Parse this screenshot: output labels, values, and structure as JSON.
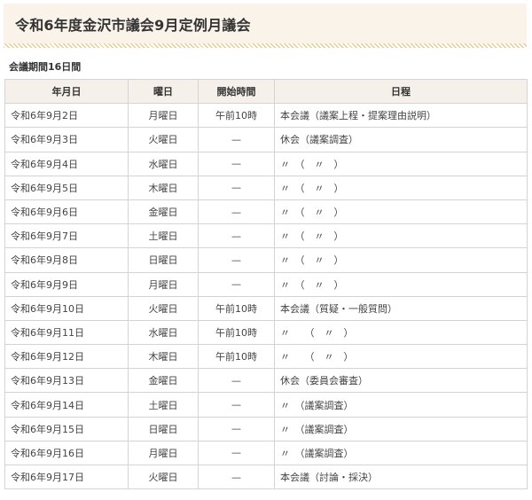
{
  "page": {
    "title": "令和6年度金沢市議会9月定例月議会",
    "subtitle": "会議期間16日間"
  },
  "table": {
    "headers": [
      "年月日",
      "曜日",
      "開始時間",
      "日程"
    ],
    "rows": [
      {
        "date": "令和6年9月2日",
        "day": "月曜日",
        "time": "午前10時",
        "plan": "本会議（議案上程・提案理由説明）"
      },
      {
        "date": "令和6年9月3日",
        "day": "火曜日",
        "time": "—",
        "plan": "休会（議案調査）"
      },
      {
        "date": "令和6年9月4日",
        "day": "水曜日",
        "time": "—",
        "plan": "〃　（　〃　）"
      },
      {
        "date": "令和6年9月5日",
        "day": "木曜日",
        "time": "—",
        "plan": "〃　（　〃　）"
      },
      {
        "date": "令和6年9月6日",
        "day": "金曜日",
        "time": "—",
        "plan": "〃　（　〃　）"
      },
      {
        "date": "令和6年9月7日",
        "day": "土曜日",
        "time": "—",
        "plan": "〃　（　〃　）"
      },
      {
        "date": "令和6年9月8日",
        "day": "日曜日",
        "time": "—",
        "plan": "〃　（　〃　）"
      },
      {
        "date": "令和6年9月9日",
        "day": "月曜日",
        "time": "—",
        "plan": "〃　（　〃　）"
      },
      {
        "date": "令和6年9月10日",
        "day": "火曜日",
        "time": "午前10時",
        "plan": "本会議（質疑・一般質問）"
      },
      {
        "date": "令和6年9月11日",
        "day": "水曜日",
        "time": "午前10時",
        "plan": "〃　　（　〃　）"
      },
      {
        "date": "令和6年9月12日",
        "day": "木曜日",
        "time": "午前10時",
        "plan": "〃　　（　〃　）"
      },
      {
        "date": "令和6年9月13日",
        "day": "金曜日",
        "time": "—",
        "plan": "休会（委員会審査）"
      },
      {
        "date": "令和6年9月14日",
        "day": "土曜日",
        "time": "—",
        "plan": "〃　（議案調査）"
      },
      {
        "date": "令和6年9月15日",
        "day": "日曜日",
        "time": "—",
        "plan": "〃　（議案調査）"
      },
      {
        "date": "令和6年9月16日",
        "day": "月曜日",
        "time": "—",
        "plan": "〃　（議案調査）"
      },
      {
        "date": "令和6年9月17日",
        "day": "火曜日",
        "time": "—",
        "plan": "本会議（討論・採決）"
      }
    ]
  },
  "colors": {
    "title_background": "#faf3ea",
    "title_border_accent": "#e9c98e",
    "header_background": "#f5f0e9",
    "grid_line": "#d4d4d4"
  }
}
